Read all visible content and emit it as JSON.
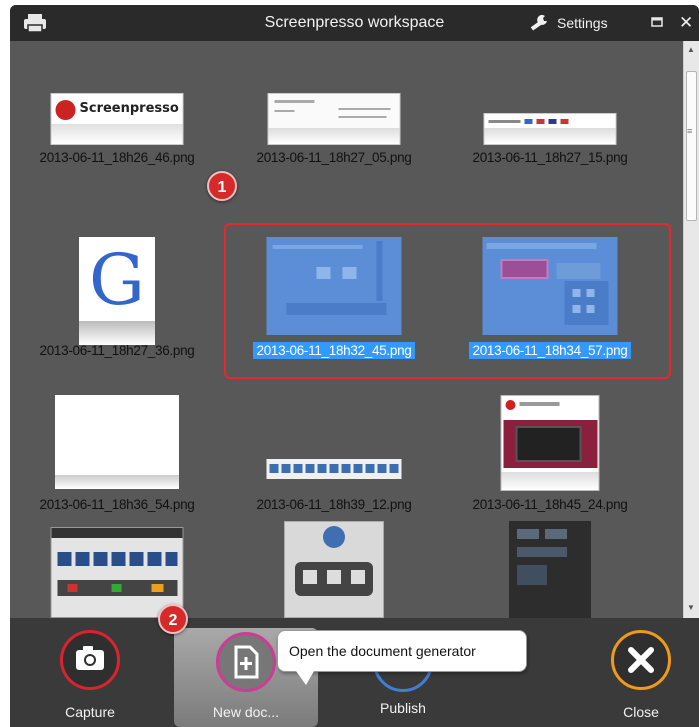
{
  "window": {
    "title": "Screenpresso workspace",
    "settings_label": "Settings"
  },
  "thumbnails": [
    {
      "file": "2013-06-11_18h26_46.png",
      "selected": false,
      "logo_text": "Screenpresso"
    },
    {
      "file": "2013-06-11_18h27_05.png",
      "selected": false
    },
    {
      "file": "2013-06-11_18h27_15.png",
      "selected": false
    },
    {
      "file": "2013-06-11_18h27_36.png",
      "selected": false,
      "logo_text": "G"
    },
    {
      "file": "2013-06-11_18h32_45.png",
      "selected": true
    },
    {
      "file": "2013-06-11_18h34_57.png",
      "selected": true
    },
    {
      "file": "2013-06-11_18h36_54.png",
      "selected": false
    },
    {
      "file": "2013-06-11_18h39_12.png",
      "selected": false
    },
    {
      "file": "2013-06-11_18h45_24.png",
      "selected": false
    },
    {
      "file": "",
      "selected": false
    },
    {
      "file": "",
      "selected": false
    },
    {
      "file": "",
      "selected": false
    }
  ],
  "markers": {
    "one": "1",
    "two": "2"
  },
  "toolbar": {
    "capture_label": "Capture",
    "newdoc_label": "New doc...",
    "publish_label": "Publish",
    "close_label": "Close"
  },
  "tooltip": {
    "text": "Open the document generator"
  },
  "colors": {
    "accent_red": "#d62a2a",
    "selection_blue": "#3399ff",
    "background": "#585858"
  }
}
